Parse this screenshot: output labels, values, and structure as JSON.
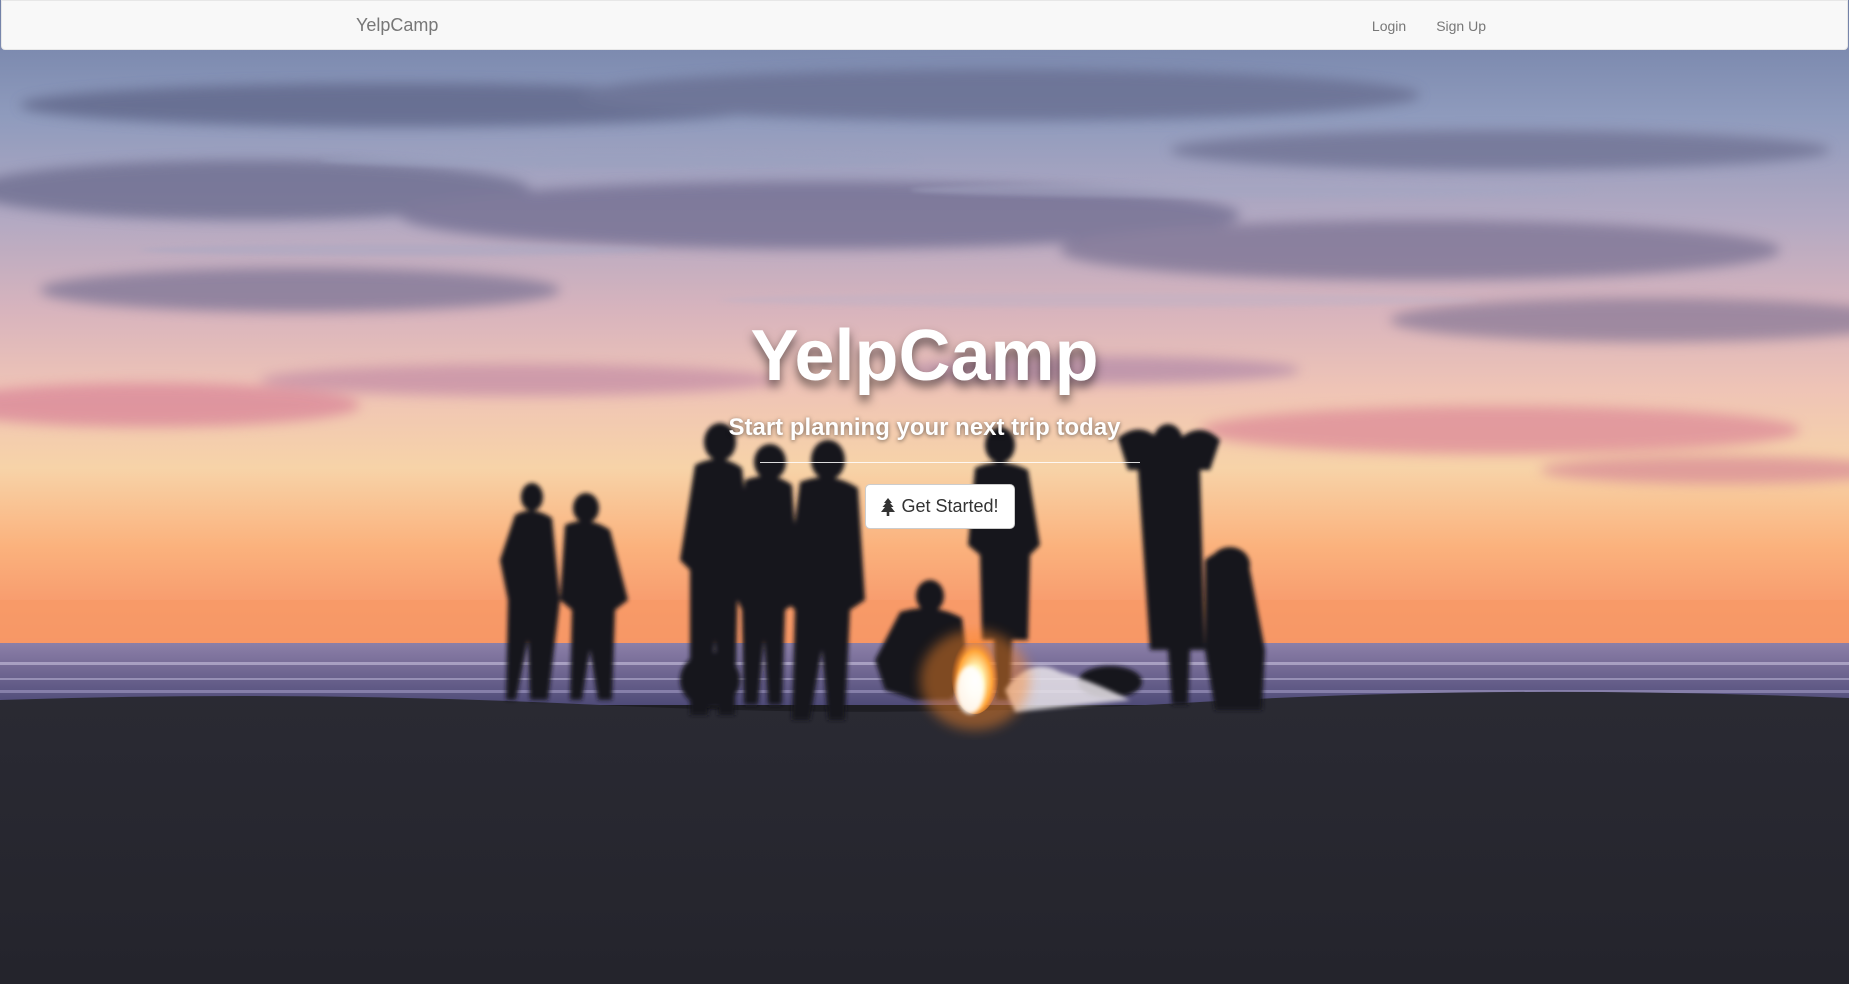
{
  "navbar": {
    "brand": "YelpCamp",
    "links": [
      {
        "label": "Login"
      },
      {
        "label": "Sign Up"
      }
    ]
  },
  "hero": {
    "title": "YelpCamp",
    "subtitle": "Start planning your next trip today",
    "cta_label": "Get Started!",
    "cta_icon": "tree-icon"
  },
  "background": {
    "description_icon": "beach-campfire-sunset-photo",
    "colors": {
      "sky_top": "#8a8fb0",
      "sky_mid": "#c9a7b8",
      "horizon_glow": "#f6a06a",
      "sea": "#6f6d9a",
      "sand": "#1f1f26"
    }
  }
}
